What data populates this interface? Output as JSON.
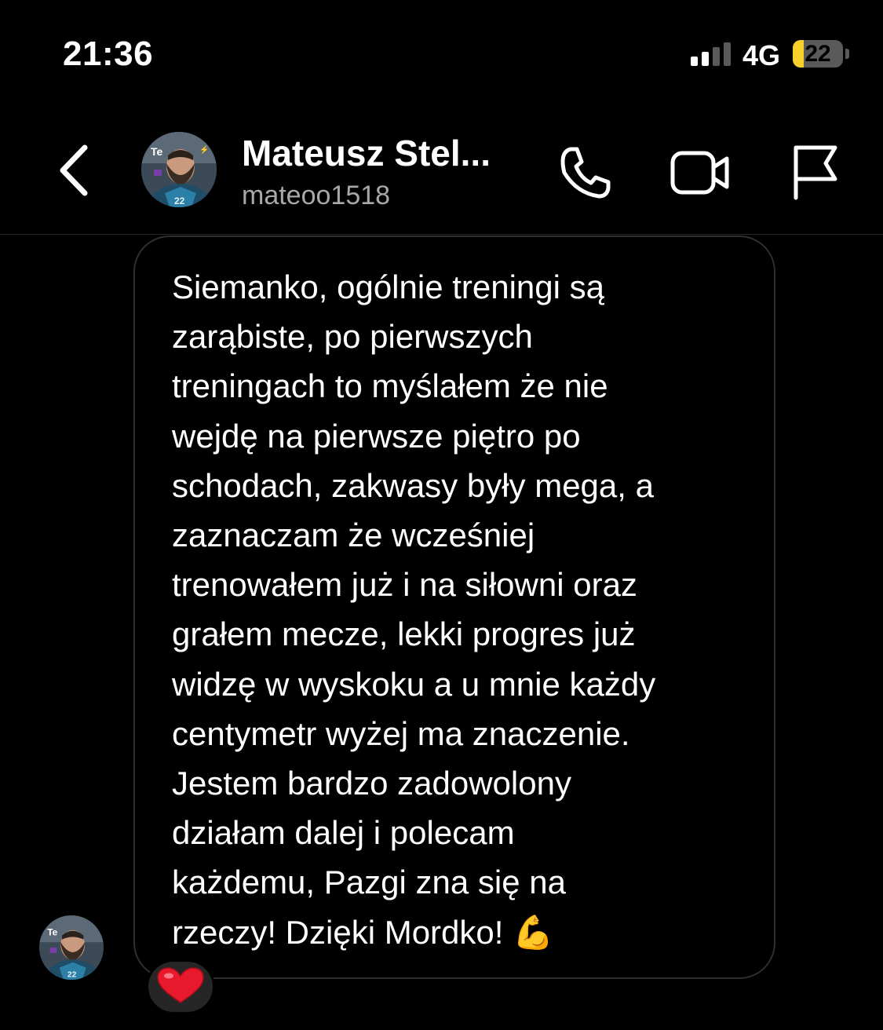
{
  "status_bar": {
    "time": "21:36",
    "network": "4G",
    "battery_percent": "22",
    "battery_level": 0.22,
    "signal_bars_active": 2,
    "signal_bars_total": 4
  },
  "header": {
    "display_name": "Mateusz Stel...",
    "username": "mateoo1518",
    "icons": {
      "back": "chevron-left-icon",
      "call": "phone-icon",
      "video": "video-camera-icon",
      "report": "flag-icon"
    }
  },
  "message": {
    "text": "Siemanko, ogólnie treningi są\nzarąbiste, po pierwszych\ntreningach to myślałem że nie\nwejdę na pierwsze piętro po\nschodach, zakwasy były mega, a\nzaznaczam że wcześniej\ntrenowałem już i na siłowni oraz\ngrałem mecze, lekki progres już\nwidzę w wyskoku a u mnie każdy\ncentymetr wyżej ma znaczenie.\nJestem bardzo zadowolony\ndziałam dalej i polecam\nkażdemu, Pazgi zna się na\nrzeczy! Dzięki Mordko! 💪",
    "reaction": "❤️"
  },
  "colors": {
    "background": "#000000",
    "text": "#ffffff",
    "secondary_text": "#a8a8a8",
    "bubble_border": "#2f2f2f",
    "reaction_bg": "#262626",
    "battery_yellow": "#f7d02c"
  }
}
